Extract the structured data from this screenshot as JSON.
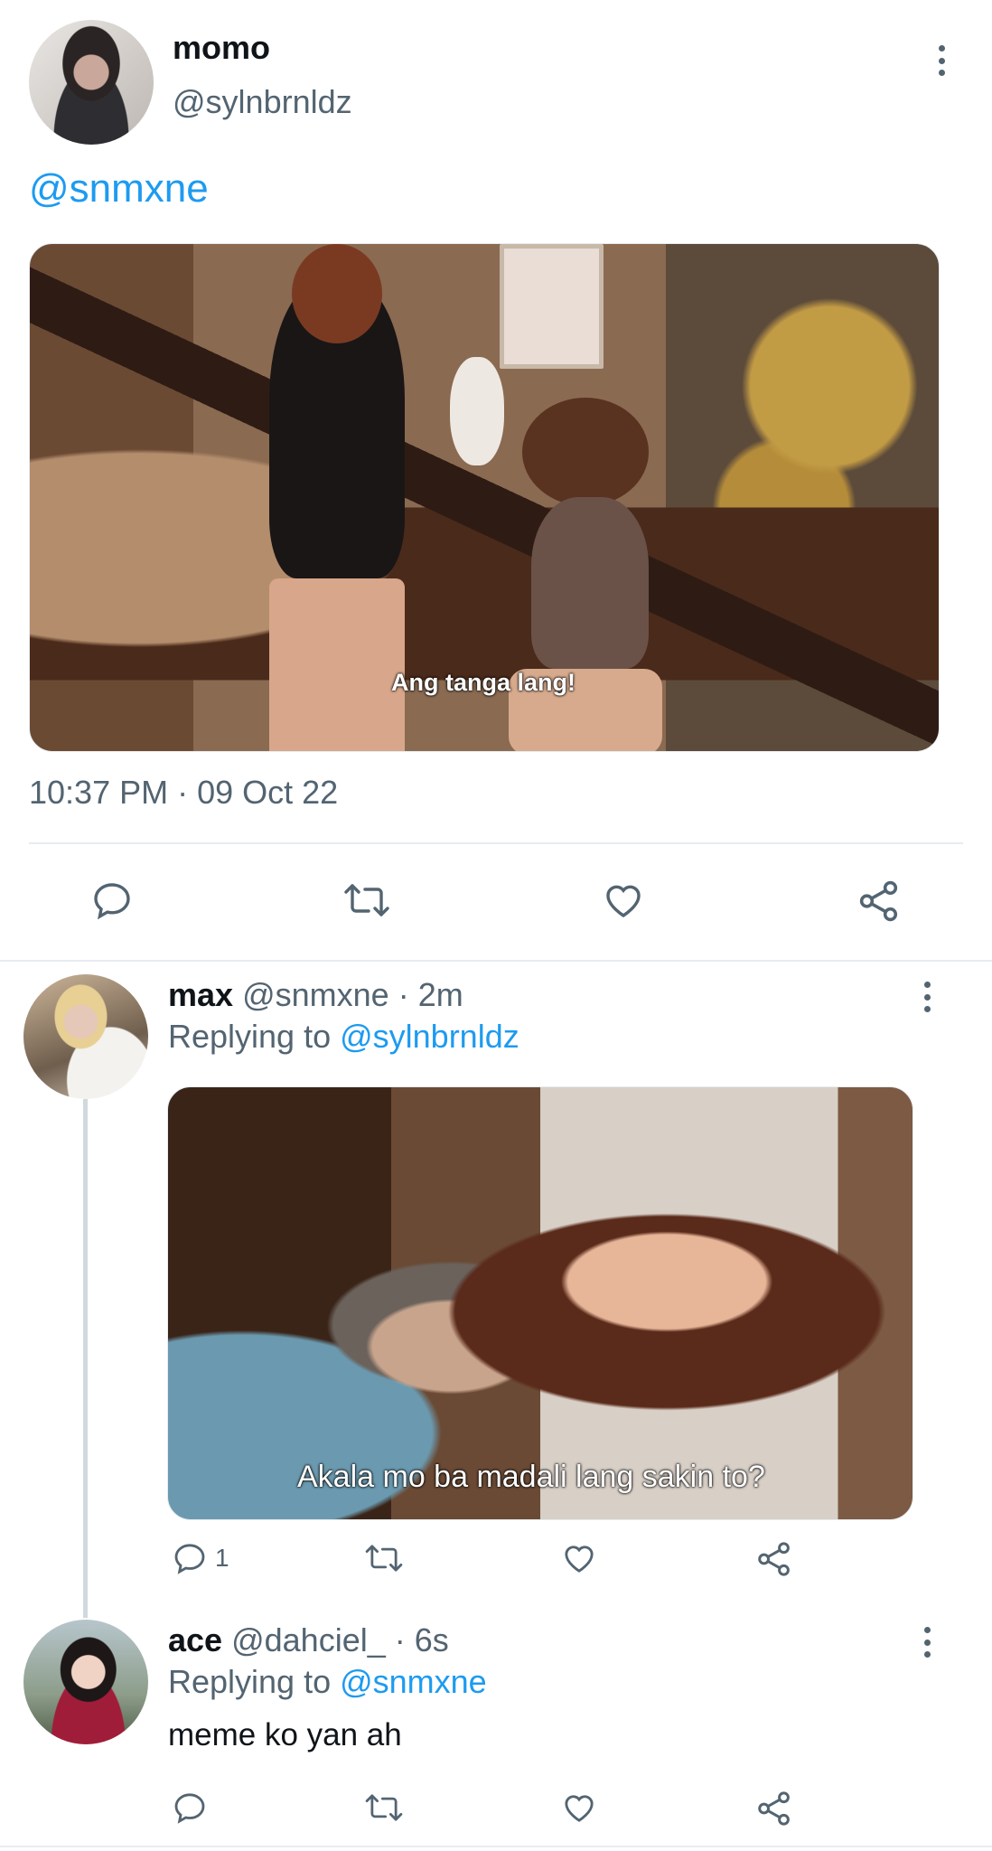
{
  "main_tweet": {
    "display_name": "momo",
    "handle": "@sylnbrnldz",
    "text": "@snmxne",
    "media_caption": "Ang tanga lang!",
    "timestamp": "10:37 PM · 09 Oct 22"
  },
  "replies": [
    {
      "display_name": "max",
      "handle": "@snmxne",
      "sep": " · ",
      "time": "2m",
      "replying_prefix": "Replying to ",
      "replying_to": "@sylnbrnldz",
      "media_caption": "Akala mo ba madali lang sakin to?",
      "reply_count": "1"
    },
    {
      "display_name": "ace",
      "handle": "@dahciel_",
      "sep": " · ",
      "time": "6s",
      "replying_prefix": "Replying to ",
      "replying_to": "@snmxne",
      "text": "meme ko yan ah"
    }
  ],
  "icons": {
    "reply": "reply-icon",
    "retweet": "retweet-icon",
    "like": "heart-icon",
    "share": "share-icon",
    "more": "more-options-icon"
  },
  "colors": {
    "link": "#1d9bf0",
    "muted": "#536471",
    "divider": "#e6ecf0"
  }
}
